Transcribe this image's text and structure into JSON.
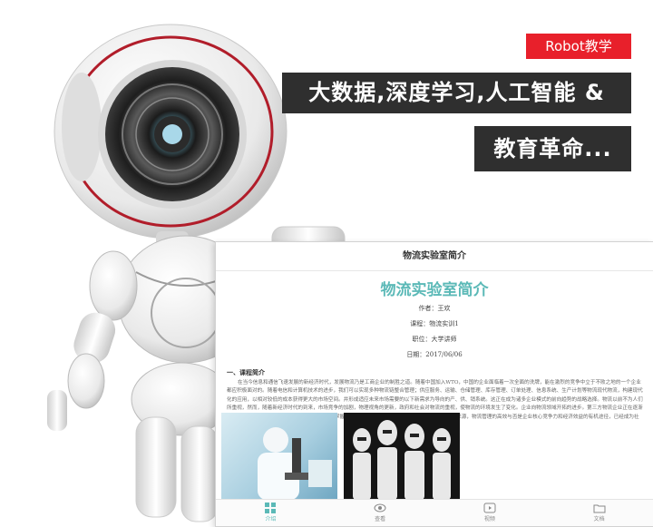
{
  "promo": {
    "tag": "Robot教学",
    "headline": "大数据,深度学习,人工智能 &",
    "subline": "教育革命..."
  },
  "screen": {
    "topbar_title": "物流实验室简介",
    "doc_title": "物流实验室简介",
    "author": "作者：王欢",
    "course": "课程：物流实训1",
    "position": "职位：大学讲师",
    "date": "日期：2017/06/06",
    "section_heading": "一、课程简介",
    "paragraph": "在当今信息和通信飞速发展的新经济时代，发展物流乃是工商企业的制胜之道。随着中国加入WTO，中国的企业面临着一次全面的洗牌，能在激烈的竞争中立于不败之地的一个企业都应积极面对的。随着电信和计算机技术的进步，我们可以实现多种物流链整合管理；供应服务、运输、仓储管理、库存管理、订单处理、信息系统、生产计划等物流现代物流，构建现代化的应用，以相对较低的成本获得更大的市场空间。并形成适应未来市场需要的以下新需求为导向的产、供、销系统。这正在成为诸多企业模式的前向趋势的战略选择。物流以前不为人们所重视，然而，随着新经济时代的到来，市场竞争的加剧，物理视角的更新，政府和社会对物流的重视，使物流的环境发生了变化。企业向物流领域开拓的进步。第三方物流企业正在逐渐兴起，国际物流企业也更加活跃，在21世纪，谁掌握了物流和配送，谁就掌握了市场，物流是第三利润来源，物流管理的高效与否是企业核心竞争力和经济效益的有机途径，已经成为社会的共识。",
    "tabs": [
      {
        "label": "介绍",
        "icon": "grid-icon"
      },
      {
        "label": "查看",
        "icon": "eye-icon"
      },
      {
        "label": "视频",
        "icon": "play-icon"
      },
      {
        "label": "文档",
        "icon": "folder-icon"
      }
    ]
  },
  "colors": {
    "accent": "#5bb9b7",
    "tag_red": "#e8202b",
    "banner_dark": "#2f2f2f"
  }
}
